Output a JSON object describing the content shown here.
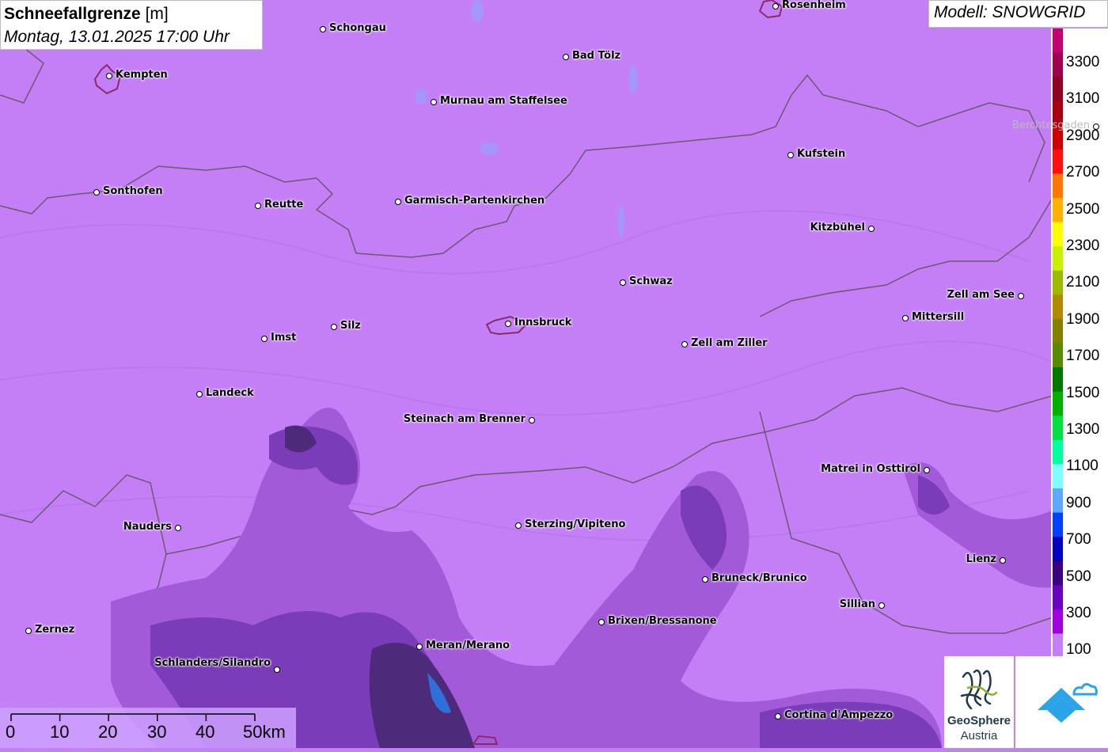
{
  "header": {
    "title": "Schneefallgrenze",
    "unit": "[m]",
    "datetime": "Montag, 13.01.2025 17:00 Uhr"
  },
  "model": "Modell: SNOWGRID",
  "legend": {
    "labels": [
      "3300",
      "3100",
      "2900",
      "2700",
      "2500",
      "2300",
      "2100",
      "1900",
      "1700",
      "1500",
      "1300",
      "1100",
      "900",
      "700",
      "500",
      "300",
      "100"
    ],
    "colors": [
      "#c40070",
      "#a0004e",
      "#8c0024",
      "#a80010",
      "#cc0000",
      "#ff1010",
      "#ff7700",
      "#ffb300",
      "#ffff00",
      "#c8f000",
      "#9eba00",
      "#b08a00",
      "#828200",
      "#5a8a00",
      "#007800",
      "#00b000",
      "#00e040",
      "#00ffa0",
      "#80ffff",
      "#60a8ff",
      "#0040ff",
      "#0000c0",
      "#3a0080",
      "#6a00c0",
      "#a000e0",
      "#c47ff7"
    ]
  },
  "cities": [
    {
      "name": "Rosenheim"
    },
    {
      "name": "Schongau"
    },
    {
      "name": "Kempten"
    },
    {
      "name": "Bad Tölz"
    },
    {
      "name": "Murnau am Staffelsee"
    },
    {
      "name": "Berchtesgaden"
    },
    {
      "name": "Kufstein"
    },
    {
      "name": "Sonthofen"
    },
    {
      "name": "Reutte"
    },
    {
      "name": "Garmisch-Partenkirchen"
    },
    {
      "name": "Kitzbühel"
    },
    {
      "name": "Schwaz"
    },
    {
      "name": "Zell am See"
    },
    {
      "name": "Mittersill"
    },
    {
      "name": "Imst"
    },
    {
      "name": "Silz"
    },
    {
      "name": "Innsbruck"
    },
    {
      "name": "Zell am Ziller"
    },
    {
      "name": "Landeck"
    },
    {
      "name": "Steinach am Brenner"
    },
    {
      "name": "Matrei in Osttirol"
    },
    {
      "name": "Nauders"
    },
    {
      "name": "Sterzing/Vipiteno"
    },
    {
      "name": "Lienz"
    },
    {
      "name": "Bruneck/Brunico"
    },
    {
      "name": "Sillian"
    },
    {
      "name": "Brixen/Bressanone"
    },
    {
      "name": "Zernez"
    },
    {
      "name": "Meran/Merano"
    },
    {
      "name": "Schlanders/Silandro"
    },
    {
      "name": "Cortina d'Ampezzo"
    }
  ],
  "scale": {
    "ticks": [
      "0",
      "10",
      "20",
      "30",
      "40",
      "50km"
    ]
  },
  "logos": {
    "geosphere_name": "GeoSphere",
    "geosphere_sub": "Austria",
    "snowgrid_icon": "mountain-cloud-icon"
  }
}
